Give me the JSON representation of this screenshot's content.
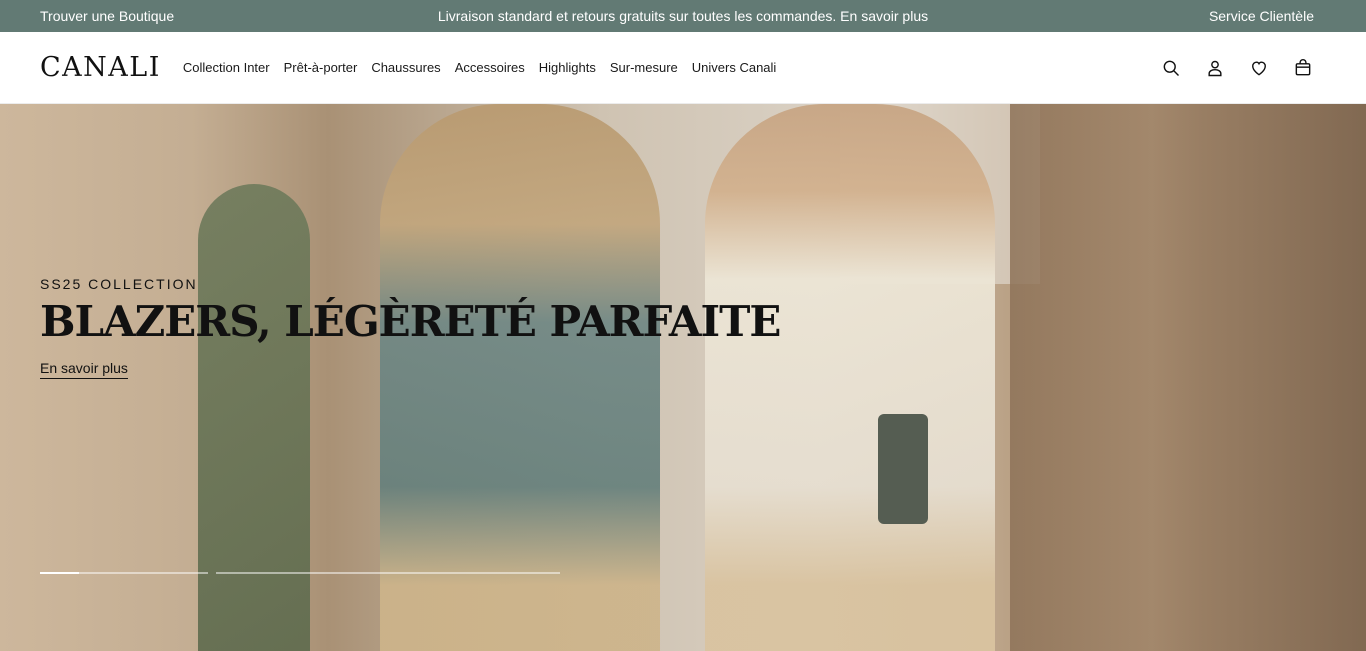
{
  "topbar": {
    "left_link": "Trouver une Boutique",
    "center_text": "Livraison standard et retours gratuits sur toutes les commandes. En savoir plus",
    "right_link": "Service Clientèle"
  },
  "header": {
    "logo": "CANALI",
    "nav": [
      "Collection Inter",
      "Prêt-à-porter",
      "Chaussures",
      "Accessoires",
      "Highlights",
      "Sur-mesure",
      "Univers Canali"
    ],
    "icons": [
      "search-icon",
      "account-icon",
      "wishlist-heart-icon",
      "shopping-bag-icon"
    ]
  },
  "hero": {
    "eyebrow": "SS25 COLLECTION",
    "title": "BLAZERS, LÉGÈRETÉ PARFAITE",
    "link": "En savoir plus",
    "slides": [
      {
        "progress": 0.23
      },
      {
        "progress": 0
      }
    ]
  },
  "colors": {
    "topbar_bg": "#627a74",
    "header_bg": "#ffffff",
    "text": "#111111"
  }
}
